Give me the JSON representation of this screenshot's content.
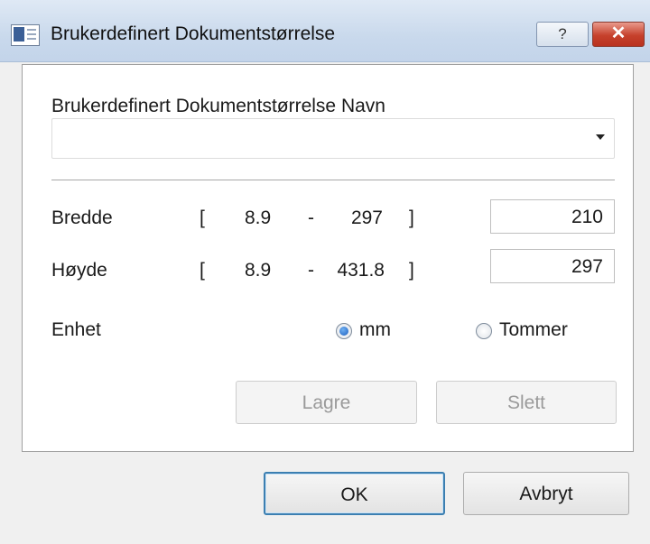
{
  "window": {
    "title": "Brukerdefinert Dokumentstørrelse",
    "help_label": "?",
    "close_label": "✕"
  },
  "form": {
    "name_label": "Brukerdefinert Dokumentstørrelse Navn",
    "name_value": "",
    "width": {
      "label": "Bredde",
      "bracket_open": "[",
      "min": "8.9",
      "dash": "-",
      "max": "297",
      "bracket_close": "]",
      "value": "210"
    },
    "height": {
      "label": "Høyde",
      "bracket_open": "[",
      "min": "8.9",
      "dash": "-",
      "max": "431.8",
      "bracket_close": "]",
      "value": "297"
    },
    "unit": {
      "label": "Enhet",
      "options": [
        "mm",
        "Tommer"
      ],
      "selected": "mm"
    },
    "save_label": "Lagre",
    "delete_label": "Slett"
  },
  "footer": {
    "ok_label": "OK",
    "cancel_label": "Avbryt"
  },
  "colors": {
    "accent": "#3c7fb1",
    "close": "#c6412c"
  }
}
